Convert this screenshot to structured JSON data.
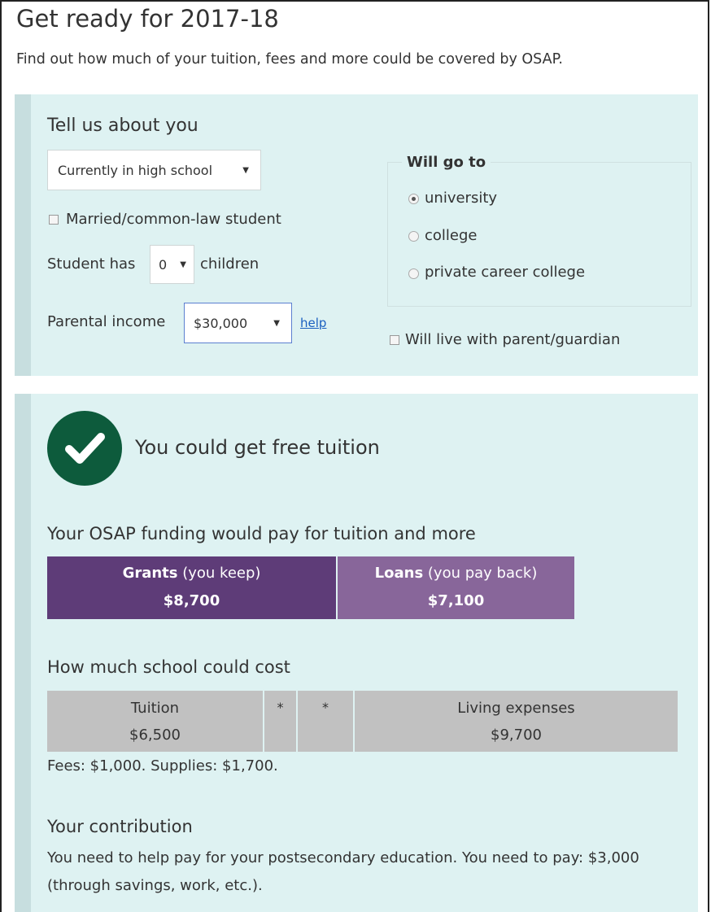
{
  "page": {
    "title": "Get ready for 2017-18",
    "intro": "Find out how much of your tuition, fees and more could be covered by OSAP."
  },
  "about": {
    "heading": "Tell us about you",
    "status_select": "Currently in high school",
    "married_label": "Married/common-law student",
    "married_checked": false,
    "children_prefix": "Student has",
    "children_value": "0",
    "children_suffix": "children",
    "income_label": "Parental income",
    "income_value": "$30,000",
    "help_link": "help",
    "will_go_to": {
      "legend": "Will go to",
      "options": [
        "university",
        "college",
        "private career college"
      ],
      "selected": "university"
    },
    "live_with_parent_label": "Will live with parent/guardian",
    "live_with_parent_checked": false
  },
  "result": {
    "headline": "You could get free tuition",
    "funding_heading": "Your OSAP funding would pay for tuition and more",
    "grants": {
      "label_bold": "Grants",
      "label_rest": " (you keep)",
      "amount": "$8,700",
      "color": "#5e3c78"
    },
    "loans": {
      "label_bold": "Loans",
      "label_rest": " (you pay back)",
      "amount": "$7,100",
      "color": "#88669a"
    },
    "cost_heading": "How much school could cost",
    "cost": {
      "tuition_label": "Tuition",
      "tuition_amount": "$6,500",
      "star1": "*",
      "star2": "*",
      "living_label": "Living expenses",
      "living_amount": "$9,700"
    },
    "fees_note": "Fees: $1,000. Supplies: $1,700.",
    "contribution_heading": "Your contribution",
    "contribution_text": "You need to help pay for your postsecondary education. You need to pay: $3,000 (through savings, work, etc.)."
  }
}
